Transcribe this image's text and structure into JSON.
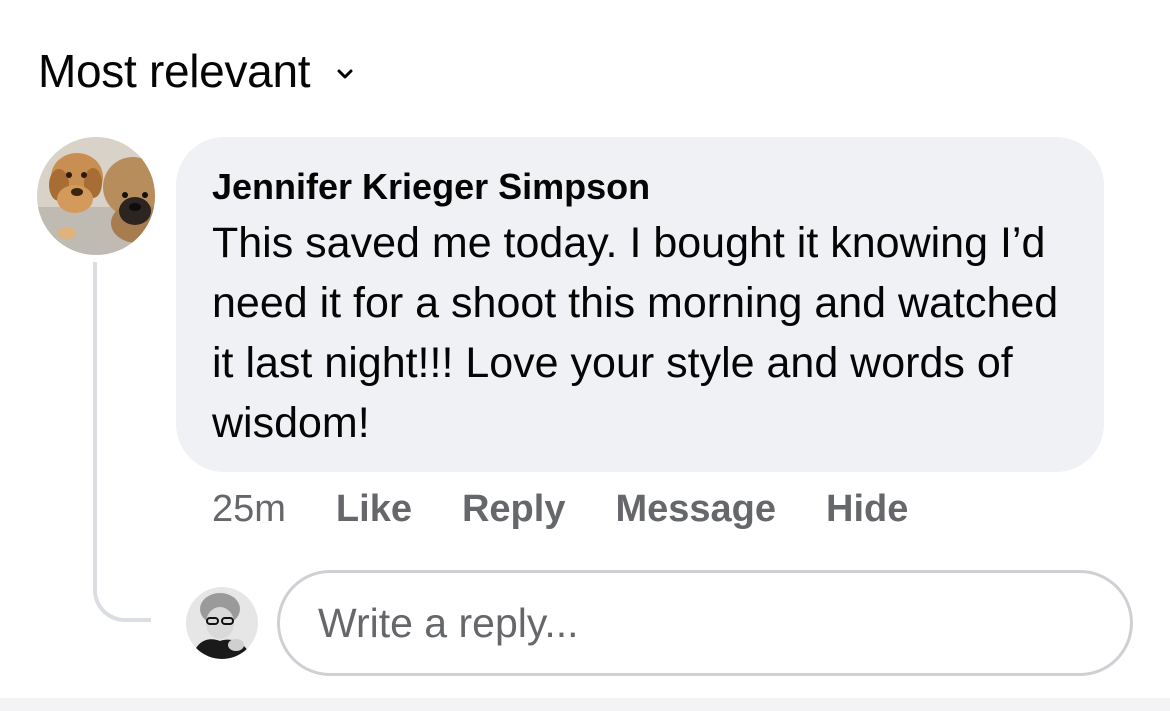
{
  "sort": {
    "label": "Most relevant",
    "icon": "chevron-down-icon"
  },
  "comment": {
    "author": "Jennifer Krieger Simpson",
    "text": "This saved me today. I bought it knowing I’d need it for a shoot this morning and watched it last night!!! Love your style and words of wisdom!",
    "time": "25m",
    "avatar": "dogs-avatar",
    "actions": {
      "like": "Like",
      "reply": "Reply",
      "message": "Message",
      "hide": "Hide"
    }
  },
  "reply_input": {
    "placeholder": "Write a reply...",
    "value": "",
    "avatar": "user-avatar"
  },
  "colors": {
    "text_primary": "#050505",
    "text_secondary": "#65676b",
    "bubble_bg": "#f0f1f5",
    "border": "#ced0d4",
    "thread_line": "#dadde1"
  }
}
